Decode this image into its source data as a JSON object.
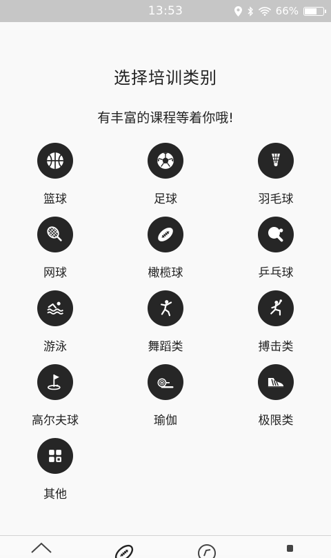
{
  "status_bar": {
    "time": "13:53",
    "battery_percent": "66%",
    "battery_level": 0.66
  },
  "header": {
    "title": "选择培训类别",
    "subtitle": "有丰富的课程等着你哦!"
  },
  "categories": [
    {
      "label": "篮球",
      "icon": "basketball-icon"
    },
    {
      "label": "足球",
      "icon": "soccer-ball-icon"
    },
    {
      "label": "羽毛球",
      "icon": "shuttlecock-icon"
    },
    {
      "label": "网球",
      "icon": "tennis-racket-icon"
    },
    {
      "label": "橄榄球",
      "icon": "football-icon"
    },
    {
      "label": "乒乓球",
      "icon": "ping-pong-paddle-icon"
    },
    {
      "label": "游泳",
      "icon": "swimmer-icon"
    },
    {
      "label": "舞蹈类",
      "icon": "dancer-icon"
    },
    {
      "label": "搏击类",
      "icon": "fighter-icon"
    },
    {
      "label": "高尔夫球",
      "icon": "golf-flag-icon"
    },
    {
      "label": "瑜伽",
      "icon": "yoga-mat-icon"
    },
    {
      "label": "极限类",
      "icon": "sneaker-icon"
    },
    {
      "label": "其他",
      "icon": "grid-apps-icon"
    }
  ],
  "tab_bar": {
    "tabs": [
      "home-icon",
      "football-icon",
      "compass-icon",
      "profile-icon"
    ]
  }
}
